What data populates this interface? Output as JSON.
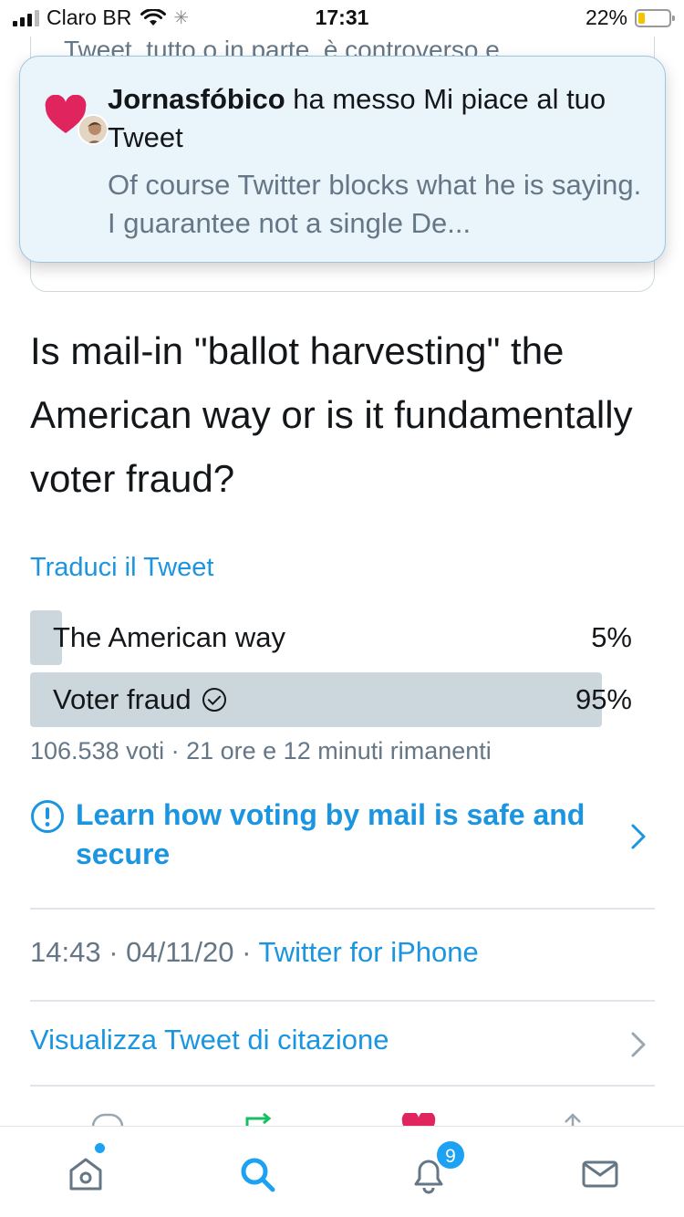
{
  "status_bar": {
    "carrier": "Claro BR",
    "time": "17:31",
    "battery": "22%",
    "battery_level": 0.22
  },
  "quoted_card": {
    "visible_text": "Tweet, tutto o in parte, è controverso e"
  },
  "notification": {
    "user": "Jornasfóbico",
    "action": " ha messo Mi piace al tuo Tweet",
    "preview": "Of course Twitter blocks what he is saying. I guarantee not a single De...",
    "icon": "heart-icon",
    "accent": "#e0245e"
  },
  "tweet": {
    "text": "Is mail-in \"ballot harvesting\" the American way or is it fundamentally voter fraud?",
    "translate_label": "Traduci il Tweet"
  },
  "poll": {
    "options": [
      {
        "label": "The American way",
        "percent_label": "5%",
        "fraction": 0.05
      },
      {
        "label": "Voter fraud",
        "percent_label": "95%",
        "fraction": 0.95
      }
    ],
    "meta": "106.538 voti · 21 ore e 12 minuti rimanenti"
  },
  "learn_link": {
    "text": "Learn how voting by mail is safe and secure",
    "icon": "info-icon"
  },
  "meta": {
    "time": "14:43",
    "date": "04/11/20",
    "separator": " · ",
    "source": "Twitter for iPhone"
  },
  "quote_tweets_label": "Visualizza Tweet di citazione",
  "tab_bar": {
    "notifications_badge": "9",
    "accent": "#1da1f2"
  }
}
